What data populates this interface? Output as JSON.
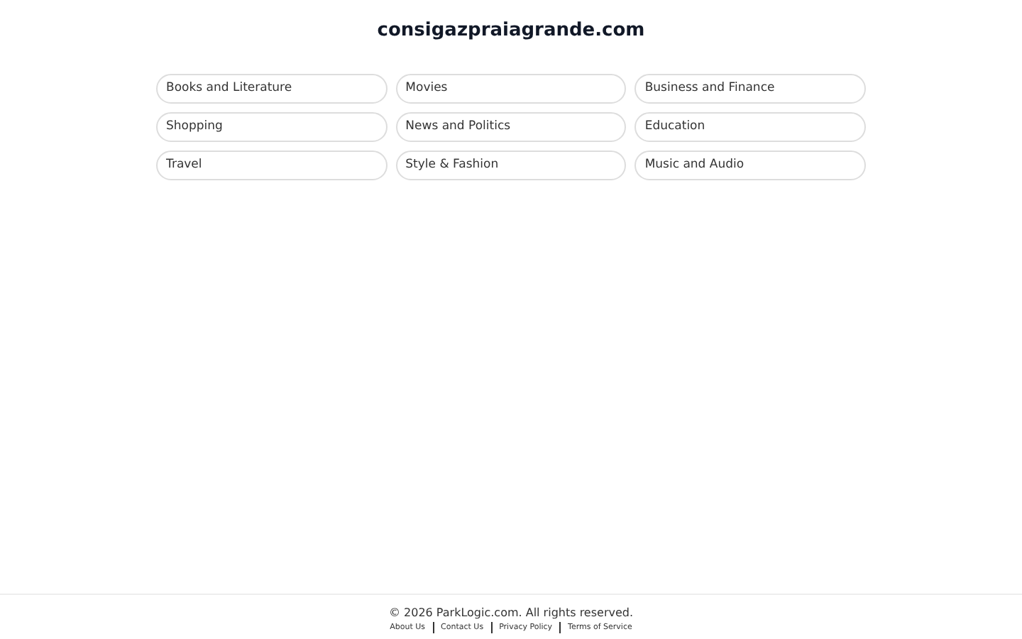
{
  "title": "consigazpraiagrande.com",
  "categories": [
    "Books and Literature",
    "Movies",
    "Business and Finance",
    "Shopping",
    "News and Politics",
    "Education",
    "Travel",
    "Style & Fashion",
    "Music and Audio"
  ],
  "footer": {
    "copyright": "© 2026 ParkLogic.com. All rights reserved.",
    "links": [
      "About Us",
      "Contact Us",
      "Privacy Policy",
      "Terms of Service"
    ]
  }
}
